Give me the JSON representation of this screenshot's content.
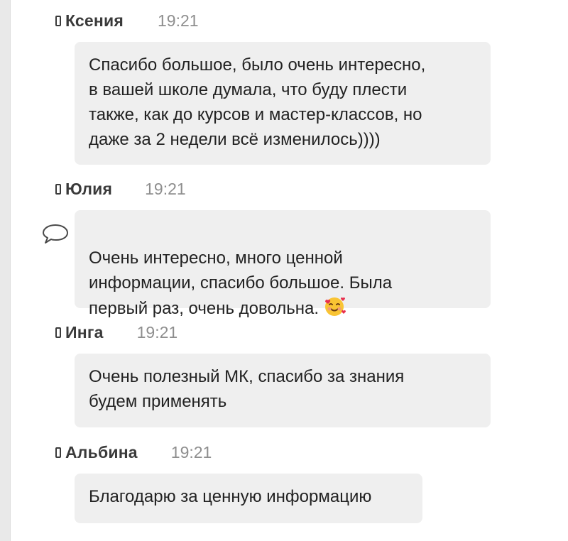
{
  "messages": [
    {
      "author": "Ксения",
      "time": "19:21",
      "text": "Спасибо большое, было очень интересно,\nв вашей школе думала, что буду плести\nтакже, как до курсов и мастер-классов, но\nдаже за 2 недели всё изменилось))))"
    },
    {
      "author": "Юлия",
      "time": "19:21",
      "text": "Очень интересно, много ценной\nинформации, спасибо большое. Была\nпервый раз, очень довольна.",
      "emoji": "smiling-face-with-hearts"
    },
    {
      "author": "Инга",
      "time": "19:21",
      "text": "Очень полезный МК, спасибо за знания\nбудем применять"
    },
    {
      "author": "Альбина",
      "time": "19:21",
      "text": "Благодарю за ценную информацию"
    }
  ],
  "colors": {
    "bubble_bg": "#efefef",
    "author": "#3a3a3a",
    "time": "#8e8e8e",
    "text": "#222222",
    "rail": "#e9e9e9"
  },
  "icons": {
    "device": "phone-icon",
    "reply": "comment-icon",
    "reaction": "smiling-face-with-hearts-emoji"
  }
}
